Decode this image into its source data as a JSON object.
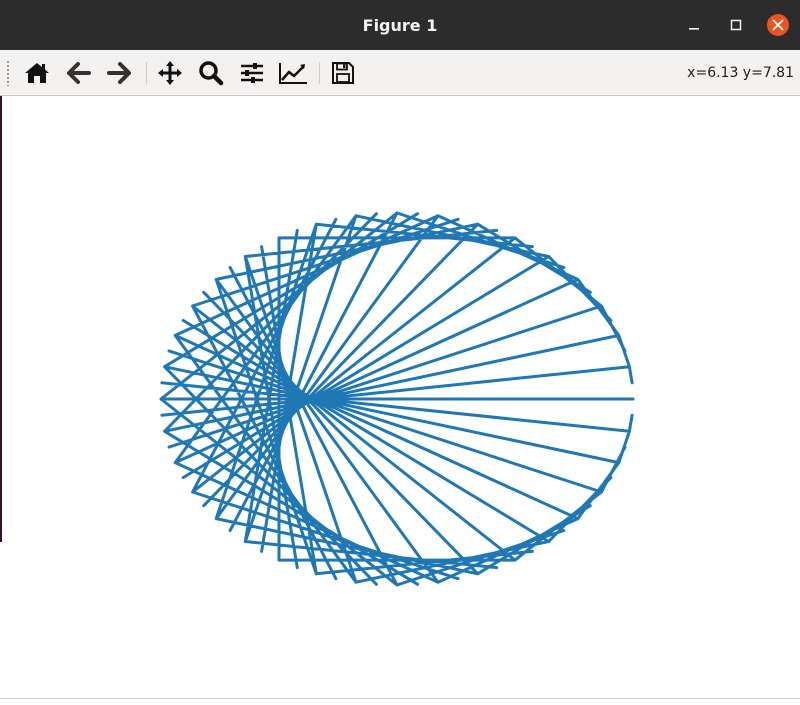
{
  "window": {
    "title": "Figure 1",
    "controls": [
      "minimize-icon",
      "maximize-icon",
      "close-icon"
    ],
    "close_color": "#e95420"
  },
  "toolbar": {
    "buttons": [
      "home-icon",
      "back-icon",
      "forward-icon",
      "pan-icon",
      "zoom-icon",
      "configure-subplots-icon",
      "edit-axes-icon",
      "save-icon"
    ],
    "coords": "x=6.13 y=7.81"
  },
  "figure": {
    "line_color": "#1f77b4",
    "background": "#ffffff"
  }
}
